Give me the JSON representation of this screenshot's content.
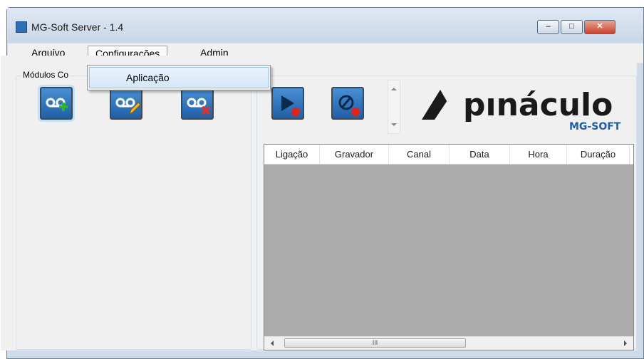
{
  "window": {
    "title": "MG-Soft Server - 1.4",
    "minimize_glyph": "–",
    "maximize_glyph": "□",
    "close_glyph": "✕"
  },
  "menu": {
    "items": [
      "Arquivo",
      "Configurações",
      "Admin"
    ],
    "open_index": 1,
    "dropdown": {
      "items": [
        "Aplicação"
      ]
    }
  },
  "modules_group": {
    "label": "Módulos Co",
    "buttons": [
      {
        "icon": "voicemail-add-icon"
      },
      {
        "icon": "voicemail-edit-icon"
      },
      {
        "icon": "voicemail-delete-icon"
      }
    ]
  },
  "recording_group": {
    "buttons": [
      {
        "icon": "play-record-icon"
      },
      {
        "icon": "stop-record-icon"
      }
    ]
  },
  "logo": {
    "name": "pinaculo",
    "subtitle": "MG-SOFT",
    "color": "#1a1a1a",
    "accent": "#1f5fa6"
  },
  "table": {
    "columns": [
      "Ligação",
      "Gravador",
      "Canal",
      "Data",
      "Hora",
      "Duração"
    ],
    "rows": [],
    "scroll_thumb_glyph": "III"
  },
  "colors": {
    "accent": "#2f6fb5",
    "titlebar": "#cfdbe9",
    "close": "#c8432d"
  }
}
